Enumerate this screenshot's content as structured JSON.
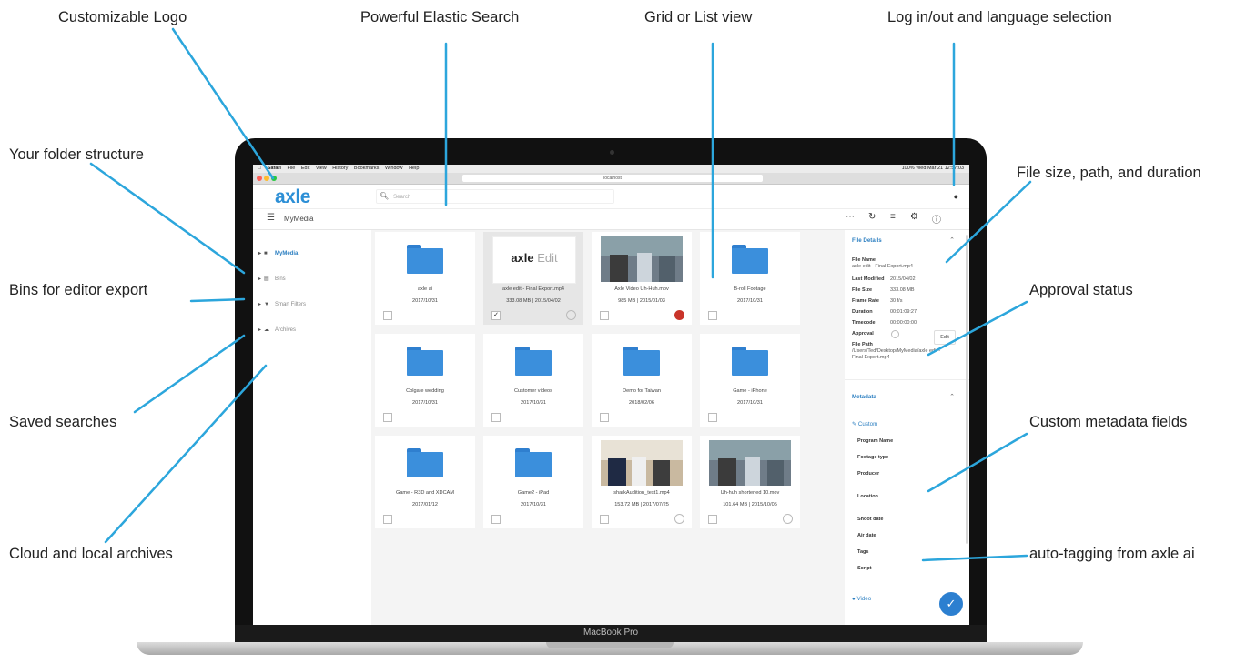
{
  "callouts": {
    "logo": "Customizable Logo",
    "search": "Powerful Elastic Search",
    "view": "Grid or List view",
    "login": "Log in/out and language selection",
    "folders": "Your folder structure",
    "fileinfo": "File size, path, and duration",
    "bins": "Bins for editor export",
    "approval": "Approval status",
    "saved": "Saved searches",
    "custom": "Custom metadata fields",
    "cloud": "Cloud and local archives",
    "autotag": "auto-tagging from axle ai"
  },
  "macos": {
    "menu": [
      "Safari",
      "File",
      "Edit",
      "View",
      "History",
      "Bookmarks",
      "Window",
      "Help"
    ],
    "status": "100%  Wed Mar 21  12:57:03",
    "url": "localhost"
  },
  "app": {
    "logo": "axle",
    "search_placeholder": "Search",
    "breadcrumb": "MyMedia"
  },
  "sidebar": [
    {
      "label": "MyMedia",
      "icon": "folder-icon"
    },
    {
      "label": "Bins",
      "icon": "bins-icon"
    },
    {
      "label": "Smart Filters",
      "icon": "filter-icon"
    },
    {
      "label": "Archives",
      "icon": "cloud-icon"
    }
  ],
  "cards": [
    {
      "name": "axle ai",
      "meta": "2017/10/31",
      "kind": "folder"
    },
    {
      "name": "axle edit - Final Export.mp4",
      "meta": "333.08 MB | 2015/04/02",
      "kind": "video",
      "thumb_text": "axle",
      "thumb_text2": " Edit",
      "selected": true,
      "approval": "none"
    },
    {
      "name": "Axle Video Uh-Huh.mov",
      "meta": "985 MB | 2015/01/03",
      "kind": "video",
      "approval": "rejected"
    },
    {
      "name": "B-roll Footage",
      "meta": "2017/10/31",
      "kind": "folder"
    },
    {
      "name": "Colgate wedding",
      "meta": "2017/10/31",
      "kind": "folder"
    },
    {
      "name": "Customer videos",
      "meta": "2017/10/31",
      "kind": "folder"
    },
    {
      "name": "Demo for Taiwan",
      "meta": "2018/02/06",
      "kind": "folder"
    },
    {
      "name": "Game - iPhone",
      "meta": "2017/10/31",
      "kind": "folder"
    },
    {
      "name": "Game - R3D and XDCAM",
      "meta": "2017/01/12",
      "kind": "folder"
    },
    {
      "name": "Game2 - iPad",
      "meta": "2017/10/31",
      "kind": "folder"
    },
    {
      "name": "sharkAudition_test1.mp4",
      "meta": "153.72 MB | 2017/07/25",
      "kind": "video",
      "approval": "none"
    },
    {
      "name": "Uh-huh shortened 10.mov",
      "meta": "101.64 MB | 2015/10/05",
      "kind": "video",
      "approval": "none"
    }
  ],
  "details": {
    "title": "File Details",
    "file_name_label": "File Name",
    "file_name": "axle edit - Final Export.mp4",
    "rows": [
      {
        "label": "Last Modified",
        "value": "2015/04/02"
      },
      {
        "label": "File Size",
        "value": "333.08 MB"
      },
      {
        "label": "Frame Rate",
        "value": "30 f/s"
      },
      {
        "label": "Duration",
        "value": "00:01:09:27"
      },
      {
        "label": "Timecode",
        "value": "00:00:00:00"
      },
      {
        "label": "Approval",
        "value": ""
      }
    ],
    "path_label": "File Path",
    "path": "/Users/Ted/Desktop/MyMedia/axle edit - Final Export.mp4"
  },
  "metadata": {
    "title": "Metadata",
    "custom_label": "Custom",
    "edit_label": "Edit",
    "fields": [
      "Program Name",
      "Footage type",
      "Producer",
      "Location",
      "Shoot date",
      "Air date",
      "Tags",
      "Script"
    ],
    "video_label": "Video"
  },
  "device": {
    "name": "MacBook Pro"
  },
  "colors": {
    "accent": "#2c7fc1",
    "folder": "#3b8fdc",
    "reject": "#c9342a",
    "callout_line": "#2ca6dc"
  }
}
